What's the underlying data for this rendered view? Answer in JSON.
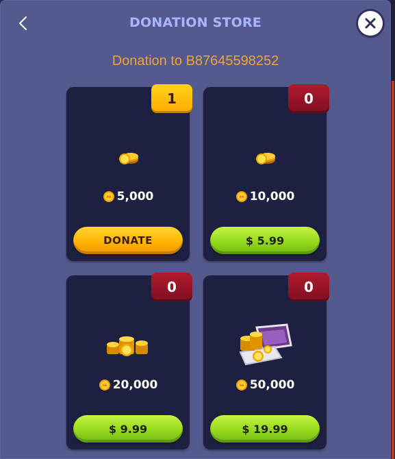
{
  "header": {
    "title": "DONATION STORE",
    "back_icon": "chevron-left-icon",
    "close_icon": "close-icon"
  },
  "subtitle": "Donation to B87645598252",
  "cards": [
    {
      "badge": "1",
      "badge_color": "#ffc107",
      "amount": "5,000",
      "action": "DONATE",
      "action_color": "#ffb400",
      "art": "small-coin-pile-icon"
    },
    {
      "badge": "0",
      "badge_color": "#9c1528",
      "amount": "10,000",
      "action": "$ 5.99",
      "action_color": "#9bdc1f",
      "art": "small-coin-pile-icon"
    },
    {
      "badge": "0",
      "badge_color": "#9c1528",
      "amount": "20,000",
      "action": "$ 9.99",
      "action_color": "#9bdc1f",
      "art": "coin-stacks-icon"
    },
    {
      "badge": "0",
      "badge_color": "#9c1528",
      "amount": "50,000",
      "action": "$ 19.99",
      "action_color": "#9bdc1f",
      "art": "treasure-chest-icon"
    }
  ],
  "colors": {
    "panel": "#555a8e",
    "card": "#1e2041",
    "title": "#a9b6ff",
    "subtitle": "#f1a332"
  }
}
